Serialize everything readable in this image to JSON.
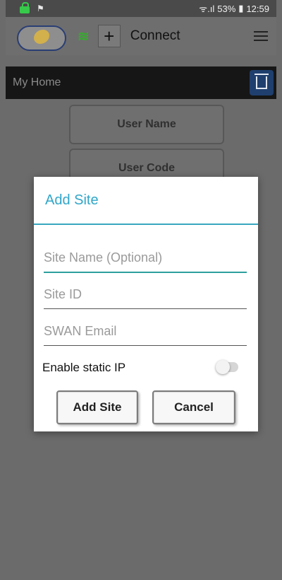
{
  "statusbar": {
    "flag_icon": "notification-flag-icon",
    "signal": "ᯤ.ıl",
    "battery": "53%",
    "time": "12:59"
  },
  "appbar": {
    "plus": "+",
    "connect": "Connect"
  },
  "subbar": {
    "title": "My Home"
  },
  "background_fields": {
    "user_name": "User Name",
    "user_code": "User Code"
  },
  "dialog": {
    "title": "Add Site",
    "site_name_placeholder": "Site Name (Optional)",
    "site_id_placeholder": "Site ID",
    "swan_email_placeholder": "SWAN Email",
    "static_ip_label": "Enable static IP",
    "static_ip_enabled": false,
    "add_button": "Add Site",
    "cancel_button": "Cancel"
  },
  "colors": {
    "accent": "#30a6c9",
    "status_green": "#37c94a"
  }
}
